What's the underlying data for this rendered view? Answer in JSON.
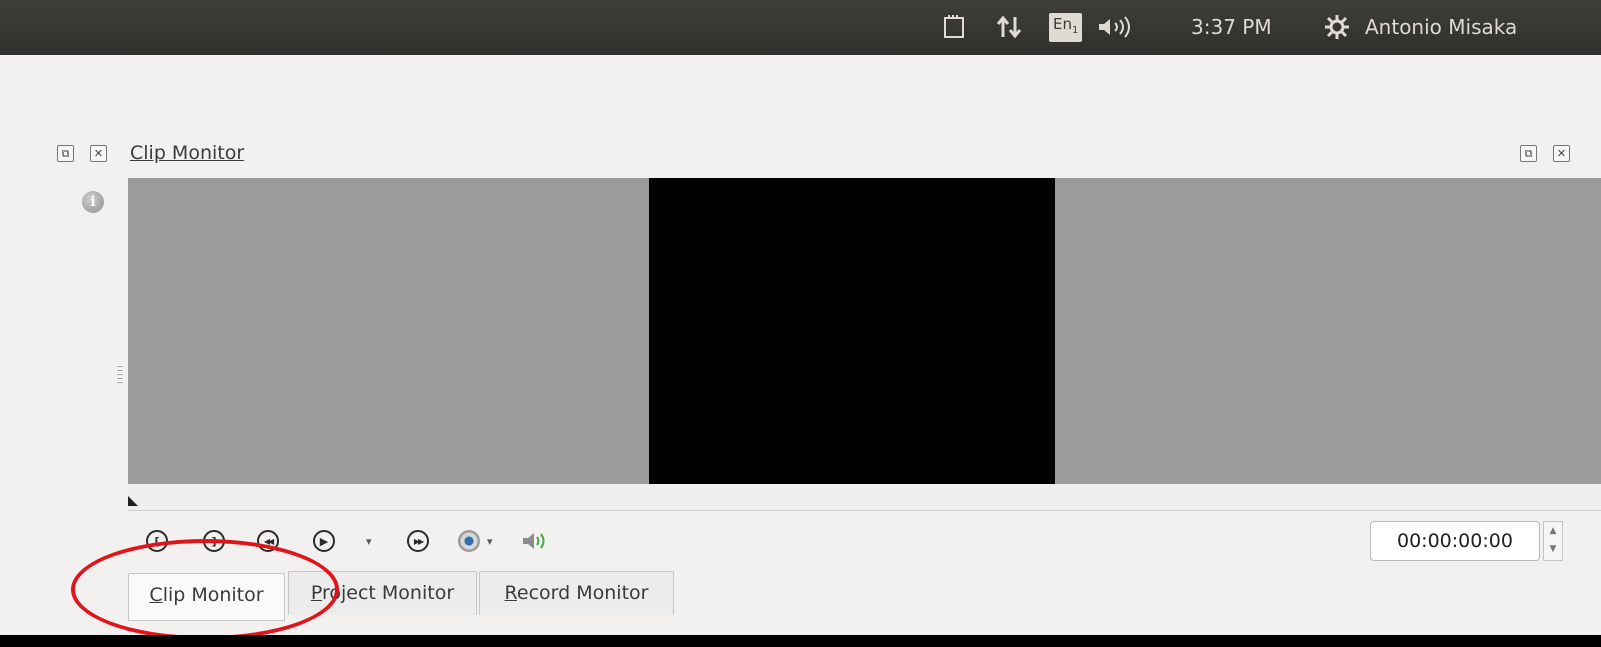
{
  "top_panel": {
    "lang": "En",
    "lang_sub": "1",
    "time": "3:37 PM",
    "user": "Antonio Misaka",
    "icons": [
      "battery-icon",
      "network-arrows-icon",
      "keyboard-layout-icon",
      "volume-icon",
      "session-gear-icon"
    ]
  },
  "dock": {
    "title": "Clip Monitor",
    "float_symbol": "⧉",
    "close_symbol": "✕",
    "info_symbol": "i"
  },
  "controls": {
    "set_zone_start": "[",
    "set_zone_end": "]",
    "rewind": "◀◀",
    "play": "▶",
    "forward": "▶▶",
    "dropdown_arrow": "▾",
    "timecode": "00:00:00:00",
    "spin_up": "▲",
    "spin_down": "▼"
  },
  "tabs": [
    {
      "label_first": "C",
      "label_rest": "lip Monitor"
    },
    {
      "label_first": "P",
      "label_rest": "roject Monitor"
    },
    {
      "label_first": "R",
      "label_rest": "ecord Monitor"
    }
  ],
  "colors": {
    "annotation_ellipse": "#e0141b",
    "monitor_background": "#9b9b9b",
    "video_frame": "#000000"
  }
}
